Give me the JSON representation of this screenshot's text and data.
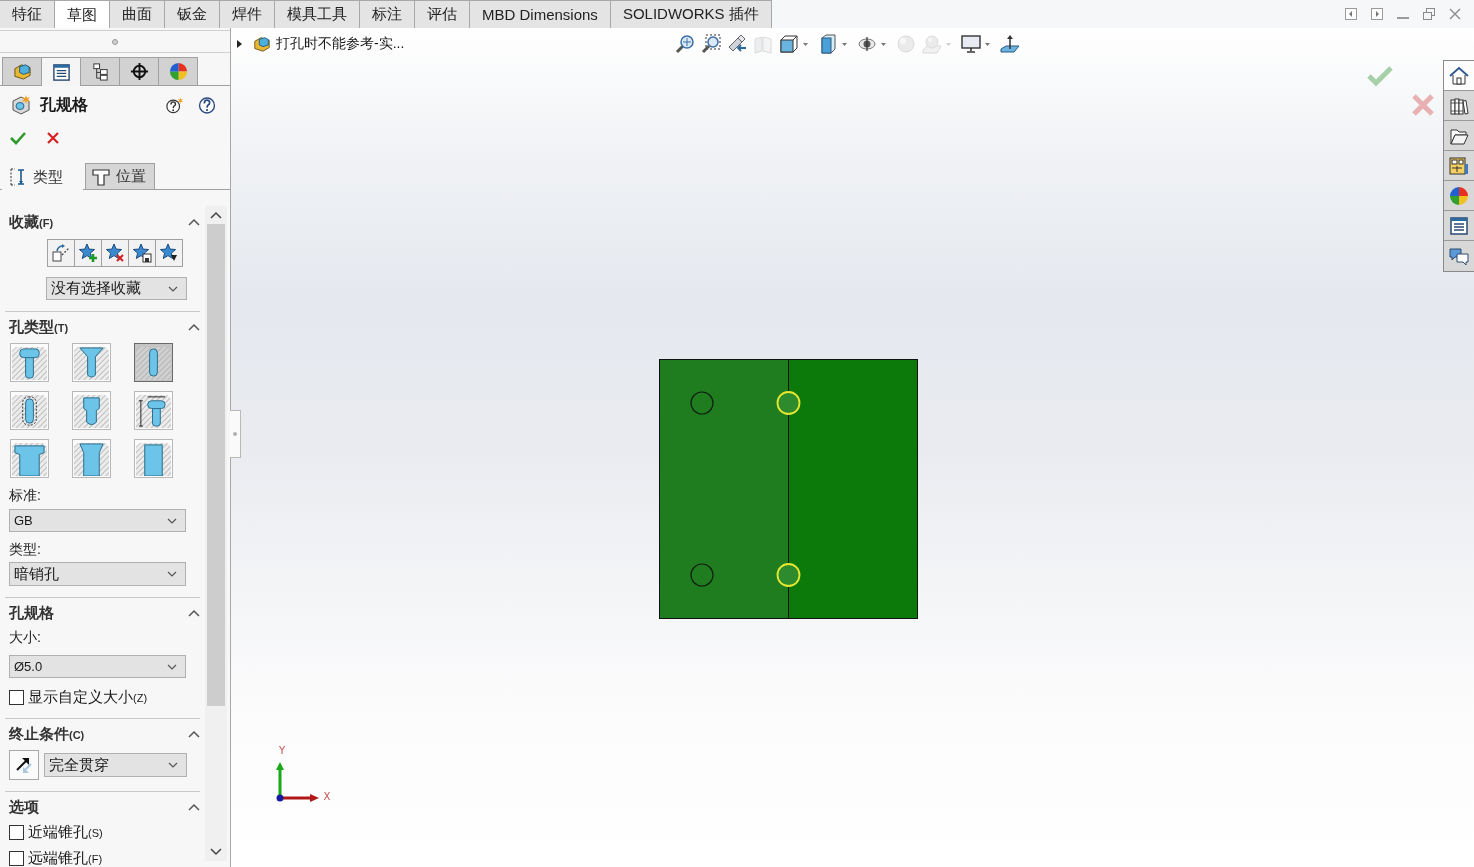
{
  "ribbon_tabs": [
    {
      "label": "特征",
      "selected": false
    },
    {
      "label": "草图",
      "selected": true
    },
    {
      "label": "曲面",
      "selected": false
    },
    {
      "label": "钣金",
      "selected": false
    },
    {
      "label": "焊件",
      "selected": false
    },
    {
      "label": "模具工具",
      "selected": false
    },
    {
      "label": "标注",
      "selected": false
    },
    {
      "label": "评估",
      "selected": false
    },
    {
      "label": "MBD Dimensions",
      "selected": false
    },
    {
      "label": "SOLIDWORKS 插件",
      "selected": false
    }
  ],
  "manager_tabs": [
    {
      "kind": "feature",
      "selected": false
    },
    {
      "kind": "property",
      "selected": true
    },
    {
      "kind": "configuration",
      "selected": false
    },
    {
      "kind": "dimxpert",
      "selected": false
    },
    {
      "kind": "display",
      "selected": false
    }
  ],
  "property_manager": {
    "title": "孔规格",
    "tabs": [
      {
        "label": "类型",
        "kind": "type",
        "selected": true
      },
      {
        "label": "位置",
        "kind": "position",
        "selected": false
      }
    ]
  },
  "favorites": {
    "title": "收藏",
    "shortcut": "(F)",
    "expanded": true,
    "dropdown": "没有选择收藏"
  },
  "hole_type": {
    "title": "孔类型",
    "shortcut": "(T)",
    "expanded": true,
    "types": [
      {
        "kind": "counterbore",
        "selected": false
      },
      {
        "kind": "countersink",
        "selected": false
      },
      {
        "kind": "hole",
        "selected": true
      },
      {
        "kind": "straight-tap",
        "selected": false
      },
      {
        "kind": "tapered-tap",
        "selected": false
      },
      {
        "kind": "legacy",
        "selected": false
      },
      {
        "kind": "counterbore-slot",
        "selected": false
      },
      {
        "kind": "countersink-slot",
        "selected": false
      },
      {
        "kind": "slot",
        "selected": false
      }
    ],
    "standard_label": "标准:",
    "standard": "GB",
    "type_label": "类型:",
    "type": "暗销孔"
  },
  "hole_spec": {
    "title": "孔规格",
    "expanded": true,
    "size_label": "大小:",
    "size": "Ø5.0",
    "custom_size": {
      "label": "显示自定义大小",
      "shortcut": "(Z)",
      "checked": false
    }
  },
  "end_condition": {
    "title": "终止条件",
    "shortcut": "(C)",
    "expanded": true,
    "value": "完全贯穿"
  },
  "options": {
    "title": "选项",
    "expanded": true,
    "items": [
      {
        "label": "近端锥孔",
        "shortcut": "(S)",
        "checked": false
      },
      {
        "label": "远端锥孔",
        "shortcut": "(F)",
        "checked": false
      }
    ]
  },
  "viewport": {
    "breadcrumb": "打孔时不能参考-实...",
    "toolbar": [
      {
        "kind": "zoom-fit",
        "disabled": false,
        "dropdown": false
      },
      {
        "kind": "zoom-area",
        "disabled": false,
        "dropdown": false
      },
      {
        "kind": "previous-view",
        "disabled": false,
        "dropdown": false
      },
      {
        "kind": "section-view",
        "disabled": true,
        "dropdown": false
      },
      {
        "kind": "view-orientation",
        "disabled": false,
        "dropdown": true
      },
      {
        "kind": "display-style",
        "disabled": false,
        "dropdown": true
      },
      {
        "kind": "hide-show",
        "disabled": false,
        "dropdown": true
      },
      {
        "kind": "edit-appearance",
        "disabled": true,
        "dropdown": false
      },
      {
        "kind": "apply-scene",
        "disabled": true,
        "dropdown": true
      },
      {
        "kind": "view-settings",
        "disabled": false,
        "dropdown": true
      },
      {
        "kind": "plane",
        "disabled": false,
        "dropdown": false
      }
    ],
    "model": {
      "holes": [
        {
          "selected": false
        },
        {
          "selected": true
        },
        {
          "selected": false
        },
        {
          "selected": true
        }
      ]
    },
    "triad": {
      "x_label": "X",
      "y_label": "Y"
    }
  },
  "task_pane": [
    {
      "kind": "home",
      "selected": true
    },
    {
      "kind": "library",
      "selected": false
    },
    {
      "kind": "folder",
      "selected": false
    },
    {
      "kind": "view-palette",
      "selected": false
    },
    {
      "kind": "appearances",
      "selected": false
    },
    {
      "kind": "properties",
      "selected": false
    },
    {
      "kind": "forum",
      "selected": false
    }
  ]
}
